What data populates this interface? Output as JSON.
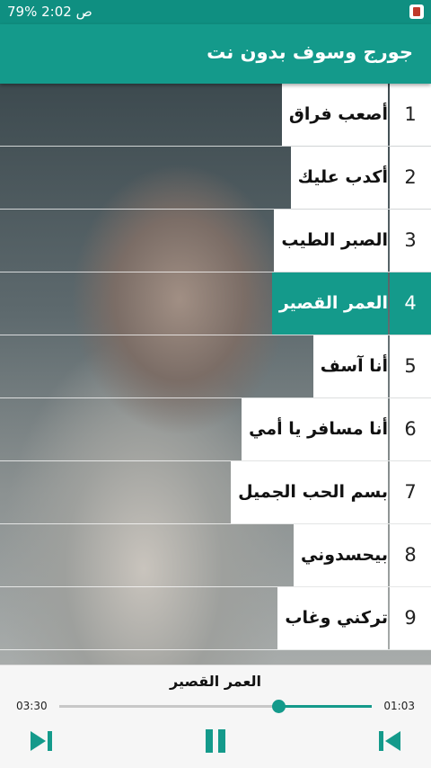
{
  "status_bar": {
    "text": "ص 2:02 %79"
  },
  "app_title": "جورج وسوف بدون نت",
  "tracks": [
    {
      "num": "1",
      "title": "أصعب فراق"
    },
    {
      "num": "2",
      "title": "أكدب عليك"
    },
    {
      "num": "3",
      "title": "الصبر الطيب"
    },
    {
      "num": "4",
      "title": "العمر القصير"
    },
    {
      "num": "5",
      "title": "أنا آسف"
    },
    {
      "num": "6",
      "title": "أنا مسافر يا أمي"
    },
    {
      "num": "7",
      "title": "بسم الحب الجميل"
    },
    {
      "num": "8",
      "title": "بيحسدوني"
    },
    {
      "num": "9",
      "title": "تركني وغاب"
    }
  ],
  "active_track_index": 3,
  "player": {
    "now_playing": "العمر القصير",
    "total_time": "03:30",
    "elapsed_time": "01:03",
    "progress": 0.3
  },
  "colors": {
    "accent": "#149a8b",
    "statusbar": "#0f8f81"
  },
  "icons": {
    "left_control": "skip-to-end-icon",
    "center_control": "pause-icon",
    "right_control": "skip-to-start-icon"
  }
}
